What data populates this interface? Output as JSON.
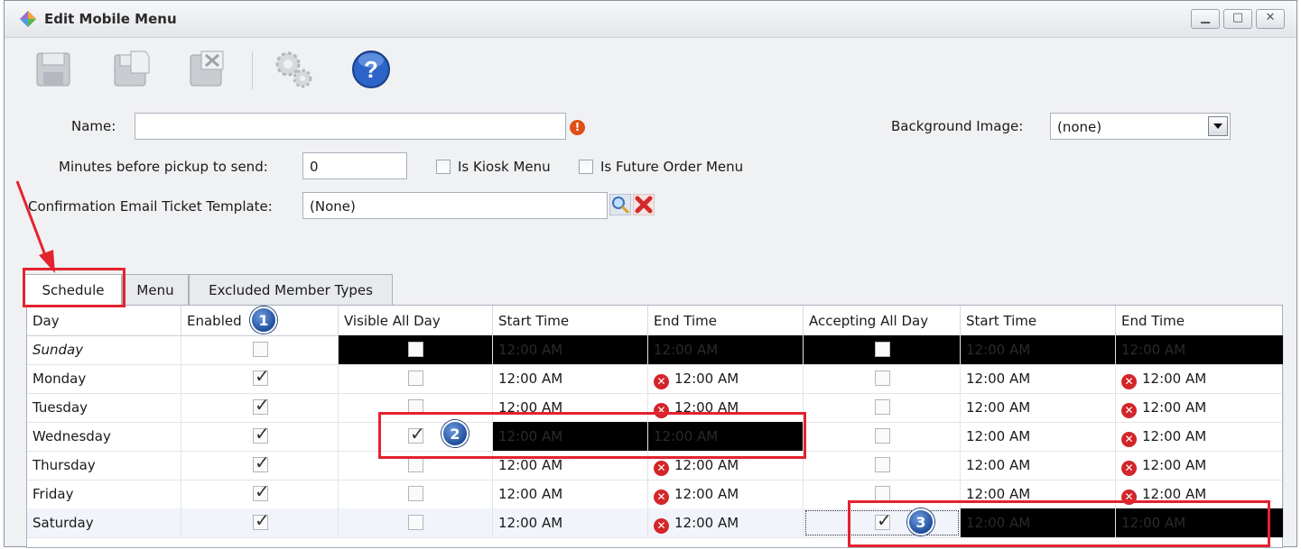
{
  "window": {
    "title": "Edit Mobile Menu",
    "buttons": [
      "minimize-icon",
      "maximize-icon",
      "close-icon"
    ]
  },
  "toolbar": {
    "icons": [
      "save-icon",
      "save-as-icon",
      "save-close-icon",
      "gears-icon",
      "help-icon"
    ]
  },
  "form": {
    "name_label": "Name:",
    "name_value": "",
    "minutes_label": "Minutes before pickup to send:",
    "minutes_value": "0",
    "kiosk_label": "Is Kiosk Menu",
    "future_label": "Is Future Order Menu",
    "template_label": "Confirmation Email Ticket Template:",
    "template_value": "(None)",
    "bg_label": "Background Image:",
    "bg_value": "(none)"
  },
  "tabs": [
    {
      "label": "Schedule",
      "active": true
    },
    {
      "label": "Menu",
      "active": false
    },
    {
      "label": "Excluded Member Types",
      "active": false
    }
  ],
  "grid": {
    "headers": [
      "Day",
      "Enabled",
      "Visible All Day",
      "Start Time",
      "End Time",
      "Accepting All Day",
      "Start Time",
      "End Time"
    ],
    "rows": [
      {
        "day": "Sunday",
        "enabled": false,
        "visible_all_day": false,
        "start1": "12:00 AM",
        "end1": "12:00 AM",
        "end1_error": false,
        "accepting_all_day": false,
        "start2": "12:00 AM",
        "end2": "12:00 AM",
        "end2_error": false
      },
      {
        "day": "Monday",
        "enabled": true,
        "visible_all_day": false,
        "start1": "12:00 AM",
        "end1": "12:00 AM",
        "end1_error": true,
        "accepting_all_day": false,
        "start2": "12:00 AM",
        "end2": "12:00 AM",
        "end2_error": true
      },
      {
        "day": "Tuesday",
        "enabled": true,
        "visible_all_day": false,
        "start1": "12:00 AM",
        "end1": "12:00 AM",
        "end1_error": true,
        "accepting_all_day": false,
        "start2": "12:00 AM",
        "end2": "12:00 AM",
        "end2_error": true
      },
      {
        "day": "Wednesday",
        "enabled": true,
        "visible_all_day": true,
        "start1": "12:00 AM",
        "end1": "12:00 AM",
        "end1_error": false,
        "accepting_all_day": false,
        "start2": "12:00 AM",
        "end2": "12:00 AM",
        "end2_error": true
      },
      {
        "day": "Thursday",
        "enabled": true,
        "visible_all_day": false,
        "start1": "12:00 AM",
        "end1": "12:00 AM",
        "end1_error": true,
        "accepting_all_day": false,
        "start2": "12:00 AM",
        "end2": "12:00 AM",
        "end2_error": true
      },
      {
        "day": "Friday",
        "enabled": true,
        "visible_all_day": false,
        "start1": "12:00 AM",
        "end1": "12:00 AM",
        "end1_error": true,
        "accepting_all_day": false,
        "start2": "12:00 AM",
        "end2": "12:00 AM",
        "end2_error": true
      },
      {
        "day": "Saturday",
        "enabled": true,
        "visible_all_day": false,
        "start1": "12:00 AM",
        "end1": "12:00 AM",
        "end1_error": true,
        "accepting_all_day": true,
        "start2": "12:00 AM",
        "end2": "12:00 AM",
        "end2_error": false
      }
    ]
  },
  "annotations": {
    "badges": [
      "1",
      "2",
      "3"
    ],
    "highlight_color": "#e3232f",
    "badge_color": "#1f4e9b"
  }
}
